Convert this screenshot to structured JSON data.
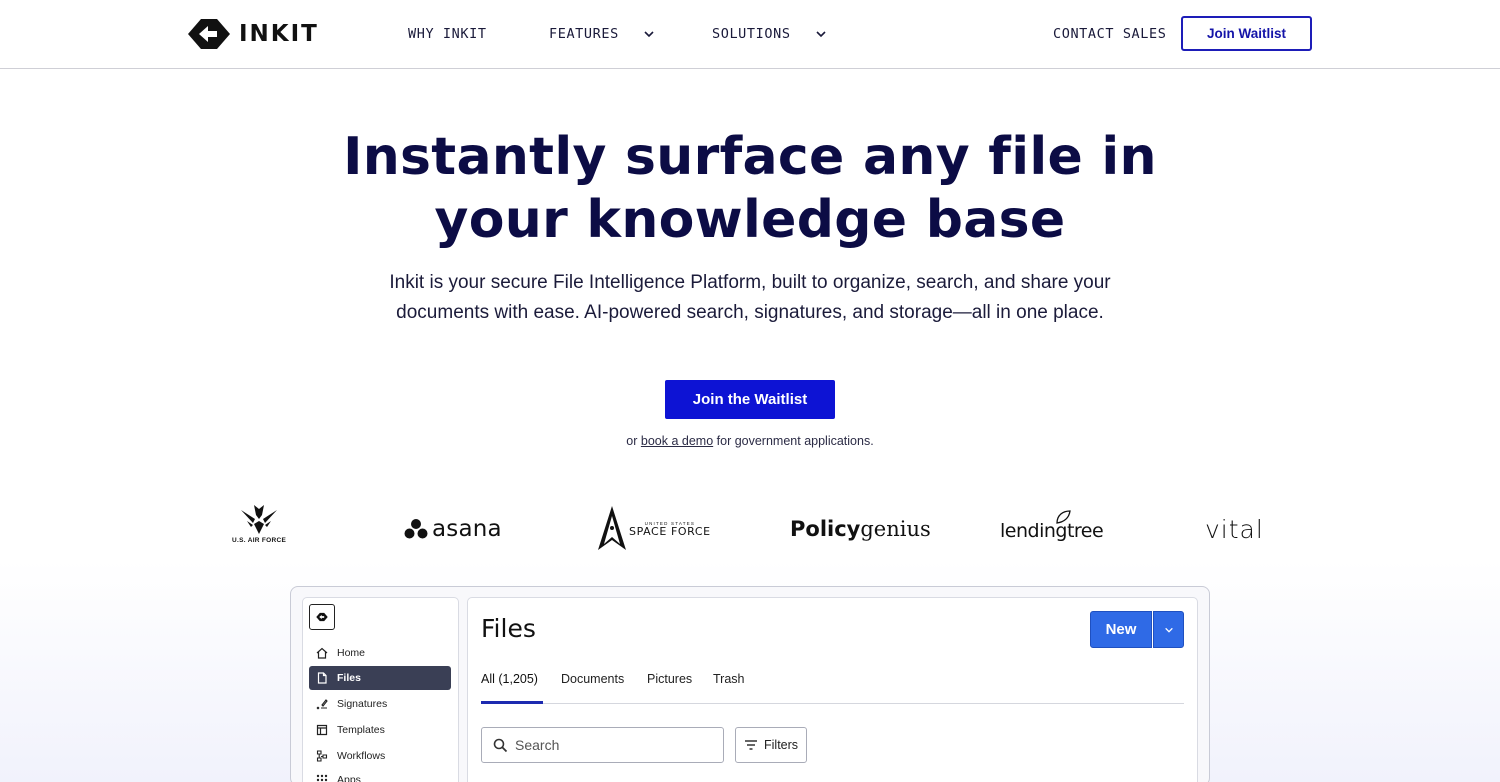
{
  "nav": {
    "logo_text": "INKIT",
    "links": [
      {
        "label": "WHY INKIT",
        "has_dropdown": false
      },
      {
        "label": "FEATURES",
        "has_dropdown": true
      },
      {
        "label": "SOLUTIONS",
        "has_dropdown": true
      }
    ],
    "contact_label": "CONTACT SALES",
    "waitlist_label": "Join Waitlist"
  },
  "hero": {
    "title_line1": "Instantly surface any file in",
    "title_line2": "your knowledge base",
    "subtitle_line1": "Inkit is your secure File Intelligence Platform, built to organize, search, and share your",
    "subtitle_line2": "documents with ease. AI-powered search, signatures, and storage—all in one place.",
    "cta_label": "Join the Waitlist",
    "demo_prefix": "or ",
    "demo_link": "book a demo",
    "demo_suffix": " for government applications."
  },
  "logos": {
    "air_force": "U.S. AIR FORCE",
    "asana": "asana",
    "space_force_small": "UNITED STATES",
    "space_force": "SPACE FORCE",
    "policy_bold": "Policy",
    "policy_light": "genius",
    "lendingtree": "lendingtree",
    "vital": "vital"
  },
  "app": {
    "sidebar": [
      {
        "label": "Home",
        "icon": "home-icon"
      },
      {
        "label": "Files",
        "icon": "file-icon",
        "active": true
      },
      {
        "label": "Signatures",
        "icon": "signature-icon"
      },
      {
        "label": "Templates",
        "icon": "templates-icon"
      },
      {
        "label": "Workflows",
        "icon": "workflows-icon"
      },
      {
        "label": "Apps",
        "icon": "apps-icon"
      }
    ],
    "title": "Files",
    "new_label": "New",
    "tabs": [
      {
        "label": "All (1,205)",
        "active": true
      },
      {
        "label": "Documents"
      },
      {
        "label": "Pictures"
      },
      {
        "label": "Trash"
      }
    ],
    "search_placeholder": "Search",
    "filters_label": "Filters"
  },
  "colors": {
    "primary": "#0d13d4",
    "title_navy": "#0c0c45",
    "app_blue": "#2f6ae6",
    "sidebar_active": "#3a3f55"
  }
}
